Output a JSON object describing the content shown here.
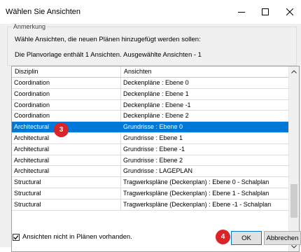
{
  "window": {
    "title": "Wählen Sie Ansichten"
  },
  "group": {
    "legend": "Anmerkung",
    "hint": "Wähle Ansichten, die neuen Plänen hinzugefügt werden sollen:",
    "info_template": "Die Planvorlage enthält 1 Ansichten.",
    "info_selected": "Ausgewählte Ansichten - 1"
  },
  "table": {
    "columns": [
      "Disziplin",
      "Ansichten"
    ],
    "rows": [
      {
        "disziplin": "Coordination",
        "ansicht": "Deckenpläne : Ebene 0"
      },
      {
        "disziplin": "Coordination",
        "ansicht": "Deckenpläne : Ebene 1"
      },
      {
        "disziplin": "Coordination",
        "ansicht": "Deckenpläne : Ebene -1"
      },
      {
        "disziplin": "Coordination",
        "ansicht": "Deckenpläne : Ebene 2"
      },
      {
        "disziplin": "Architectural",
        "ansicht": "Grundrisse : Ebene 0",
        "selected": true
      },
      {
        "disziplin": "Architectural",
        "ansicht": "Grundrisse : Ebene 1"
      },
      {
        "disziplin": "Architectural",
        "ansicht": "Grundrisse : Ebene -1"
      },
      {
        "disziplin": "Architectural",
        "ansicht": "Grundrisse : Ebene 2"
      },
      {
        "disziplin": "Architectural",
        "ansicht": "Grundrisse : LAGEPLAN"
      },
      {
        "disziplin": "Structural",
        "ansicht": "Tragwerkspläne (Deckenplan) : Ebene 0 - Schalplan"
      },
      {
        "disziplin": "Structural",
        "ansicht": "Tragwerkspläne (Deckenplan) : Ebene 1 - Schalplan"
      },
      {
        "disziplin": "Structural",
        "ansicht": "Tragwerkspläne (Deckenplan) : Ebene -1 - Schalplan"
      }
    ]
  },
  "badges": {
    "step3": "3",
    "step4": "4"
  },
  "checkbox": {
    "label": "Ansichten nicht in Plänen vorhanden.",
    "checked": true
  },
  "buttons": {
    "ok": "OK",
    "cancel": "Abbrechen"
  },
  "colors": {
    "selection": "#0078d7",
    "badge": "#d9242a",
    "dialog_bg": "#f0f0f0"
  }
}
